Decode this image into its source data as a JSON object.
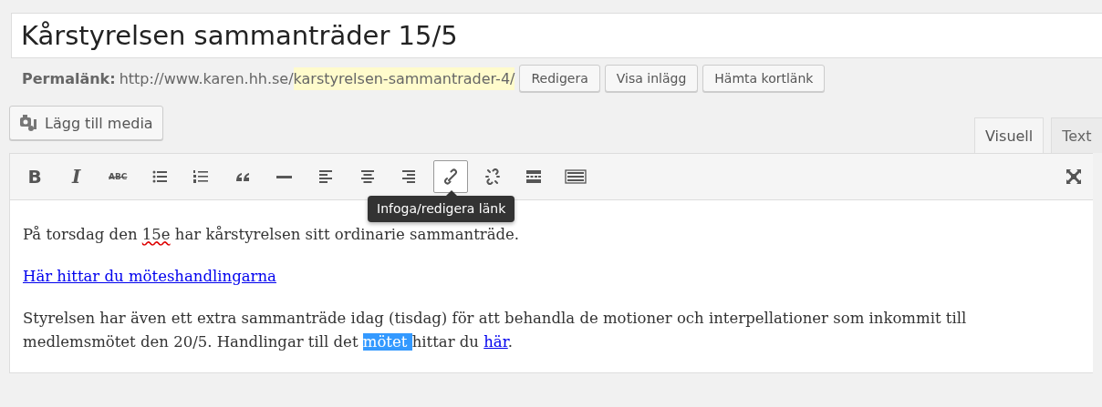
{
  "title": {
    "value": "Kårstyrelsen sammanträder 15/5"
  },
  "permalink": {
    "label": "Permalänk:",
    "base": "http://www.karen.hh.se/",
    "slug": "karstyrelsen-sammantrader-4/",
    "buttons": [
      "Redigera",
      "Visa inlägg",
      "Hämta kortlänk"
    ]
  },
  "media_button": {
    "label": "Lägg till media"
  },
  "tabs": [
    {
      "label": "Visuell",
      "selected": true
    },
    {
      "label": "Text",
      "selected": false
    }
  ],
  "toolbar": [
    {
      "kind": "bold",
      "label": "B",
      "active": false
    },
    {
      "kind": "italic",
      "label": "I",
      "active": false
    },
    {
      "kind": "strike",
      "label": "ABC",
      "active": false
    },
    {
      "kind": "bullets",
      "active": false
    },
    {
      "kind": "numbers",
      "active": false
    },
    {
      "kind": "quote",
      "active": false
    },
    {
      "kind": "rule",
      "active": false
    },
    {
      "kind": "align-left",
      "active": false
    },
    {
      "kind": "align-center",
      "active": false
    },
    {
      "kind": "align-right",
      "active": false
    },
    {
      "kind": "link",
      "active": true
    },
    {
      "kind": "unlink",
      "active": false
    },
    {
      "kind": "more",
      "active": false
    },
    {
      "kind": "kitchen",
      "active": false
    }
  ],
  "fullscreen": {
    "kind": "fullscreen"
  },
  "tooltip": {
    "text": "Infoga/redigera länk"
  },
  "content": [
    {
      "kind": "paragraph",
      "segments": [
        {
          "kind": "text",
          "text": "På torsdag den "
        },
        {
          "kind": "misspelled",
          "text": "15e"
        },
        {
          "kind": "text",
          "text": " har kårstyrelsen sitt ordinarie sammanträde."
        }
      ]
    },
    {
      "kind": "paragraph",
      "segments": [
        {
          "kind": "link",
          "text": "Här hittar du möteshandlingarna"
        }
      ]
    },
    {
      "kind": "paragraph",
      "segments": [
        {
          "kind": "text",
          "text": "Styrelsen har även ett extra sammanträde idag (tisdag) för att behandla de motioner och interpellationer som inkommit till medlemsmötet den 20/5. Handlingar till det "
        },
        {
          "kind": "selection",
          "text": "mötet "
        },
        {
          "kind": "text",
          "text": "hittar du "
        },
        {
          "kind": "link",
          "text": "här"
        },
        {
          "kind": "text",
          "text": "."
        }
      ]
    }
  ]
}
